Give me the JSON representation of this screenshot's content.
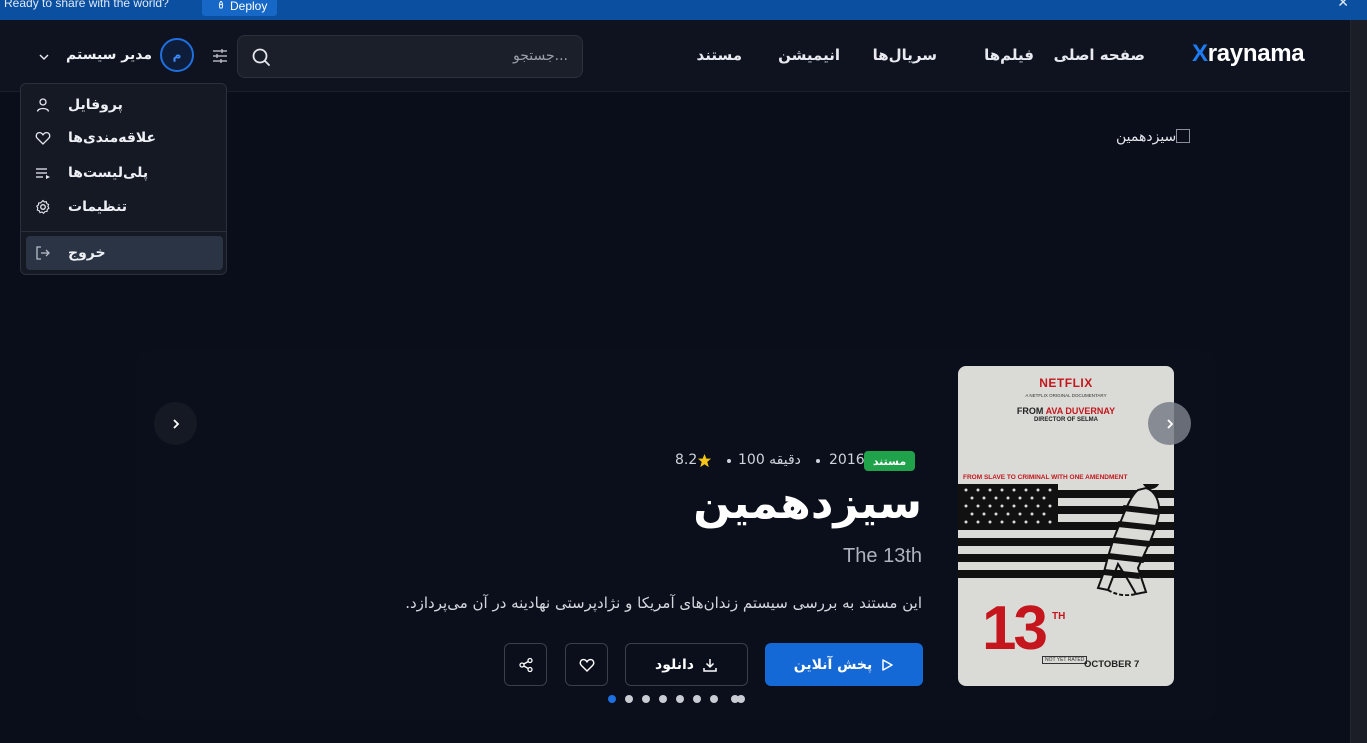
{
  "topbar": {
    "message": "Ready to share with the world?",
    "deploy_label": "Deploy",
    "close_glyph": "✕"
  },
  "header": {
    "logo_x": "X",
    "logo_rest": "raynama",
    "nav": [
      "صفحه اصلی",
      "فیلم‌ها",
      "سریال‌ها",
      "انیمیشن",
      "مستند"
    ],
    "search_placeholder": "جستجو...",
    "avatar_letter": "م",
    "user_name": "مدیر سیستم"
  },
  "user_menu": {
    "items": [
      {
        "label": "پروفایل",
        "icon": "user-icon"
      },
      {
        "label": "علاقه‌مندی‌ها",
        "icon": "heart-icon"
      },
      {
        "label": "پلی‌لیست‌ها",
        "icon": "playlist-icon"
      },
      {
        "label": "تنظیمات",
        "icon": "gear-icon"
      }
    ],
    "logout_label": "خروج"
  },
  "hero": {
    "broken_image_alt": "سیزدهمین",
    "badge": "مستند",
    "year": "2016",
    "duration": "100 دقیقه",
    "rating": "8.2",
    "title_fa": "سیزدهمین",
    "title_en": "The 13th",
    "description": "این مستند به بررسی سیستم زندان‌های آمریکا و نژادپرستی نهادینه در آن می‌پردازد.",
    "play_label": "پخش آنلاین",
    "download_label": "دانلود",
    "slide_count": 9,
    "active_slide": 0
  },
  "poster": {
    "brand": "NETFLIX",
    "original": "A NETFLIX ORIGINAL DOCUMENTARY",
    "from": "FROM",
    "director": "AVA DUVERNAY",
    "director_of": "DIRECTOR OF SELMA",
    "tagline": "FROM SLAVE TO CRIMINAL WITH ONE AMENDMENT",
    "number": "13",
    "suffix": "TH",
    "rating_box": "NOT YET RATED",
    "release": "OCTOBER 7"
  },
  "colors": {
    "accent": "#1469d6",
    "badge": "#1fa24a",
    "star": "#f5c518",
    "netflix_red": "#c4161c"
  }
}
